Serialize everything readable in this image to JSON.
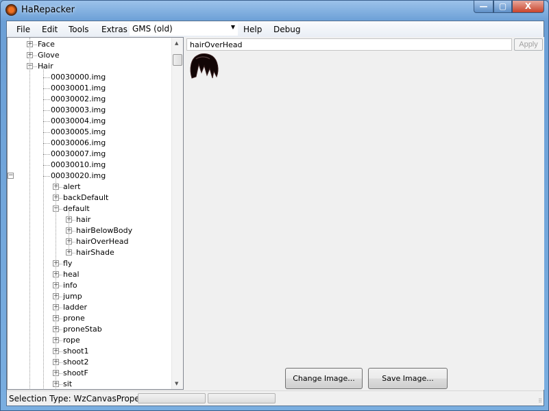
{
  "window": {
    "title": "HaRepacker",
    "controls": {
      "minimize": "—",
      "maximize": "▢",
      "close": "X"
    }
  },
  "menu": {
    "items": [
      "File",
      "Edit",
      "Tools",
      "Extras"
    ],
    "region": "GMS (old)",
    "items2": [
      "Help",
      "Debug"
    ]
  },
  "tree": {
    "rows": [
      {
        "label": "Face",
        "level": 0,
        "toggle": "+"
      },
      {
        "label": "Glove",
        "level": 0,
        "toggle": "+"
      },
      {
        "label": "Hair",
        "level": 0,
        "toggle": "-"
      },
      {
        "label": "00030000.img",
        "level": 1,
        "toggle": ""
      },
      {
        "label": "00030001.img",
        "level": 1,
        "toggle": ""
      },
      {
        "label": "00030002.img",
        "level": 1,
        "toggle": ""
      },
      {
        "label": "00030003.img",
        "level": 1,
        "toggle": ""
      },
      {
        "label": "00030004.img",
        "level": 1,
        "toggle": ""
      },
      {
        "label": "00030005.img",
        "level": 1,
        "toggle": ""
      },
      {
        "label": "00030006.img",
        "level": 1,
        "toggle": ""
      },
      {
        "label": "00030007.img",
        "level": 1,
        "toggle": ""
      },
      {
        "label": "00030010.img",
        "level": 1,
        "toggle": ""
      },
      {
        "label": "00030020.img",
        "level": 1,
        "toggle": "-"
      },
      {
        "label": "alert",
        "level": 2,
        "toggle": "+"
      },
      {
        "label": "backDefault",
        "level": 2,
        "toggle": "+"
      },
      {
        "label": "default",
        "level": 2,
        "toggle": "-"
      },
      {
        "label": "hair",
        "level": 3,
        "toggle": "+"
      },
      {
        "label": "hairBelowBody",
        "level": 3,
        "toggle": "+"
      },
      {
        "label": "hairOverHead",
        "level": 3,
        "toggle": "+"
      },
      {
        "label": "hairShade",
        "level": 3,
        "toggle": "+"
      },
      {
        "label": "fly",
        "level": 2,
        "toggle": "+"
      },
      {
        "label": "heal",
        "level": 2,
        "toggle": "+"
      },
      {
        "label": "info",
        "level": 2,
        "toggle": "+"
      },
      {
        "label": "jump",
        "level": 2,
        "toggle": "+"
      },
      {
        "label": "ladder",
        "level": 2,
        "toggle": "+"
      },
      {
        "label": "prone",
        "level": 2,
        "toggle": "+"
      },
      {
        "label": "proneStab",
        "level": 2,
        "toggle": "+"
      },
      {
        "label": "rope",
        "level": 2,
        "toggle": "+"
      },
      {
        "label": "shoot1",
        "level": 2,
        "toggle": "+"
      },
      {
        "label": "shoot2",
        "level": 2,
        "toggle": "+"
      },
      {
        "label": "shootF",
        "level": 2,
        "toggle": "+"
      },
      {
        "label": "sit",
        "level": 2,
        "toggle": "+"
      }
    ]
  },
  "editor": {
    "name_value": "hairOverHead",
    "apply": "Apply",
    "change_image": "Change Image...",
    "save_image": "Save Image..."
  },
  "status": {
    "text": "Selection Type: WzCanvasProperty"
  }
}
